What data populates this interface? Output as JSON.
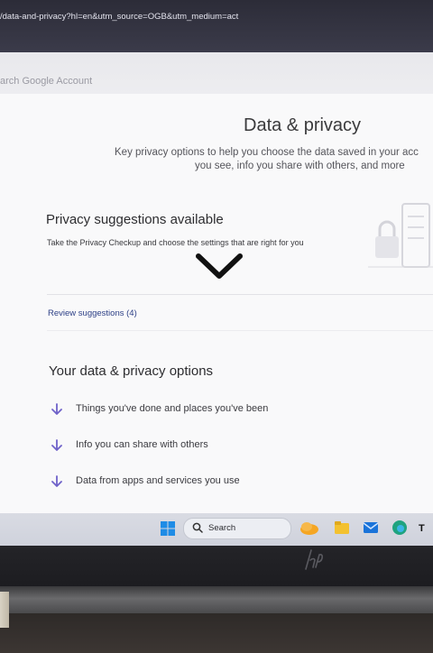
{
  "browser": {
    "url_fragment": "/data-and-privacy?hl=en&utm_source=OGB&utm_medium=act"
  },
  "header": {
    "search_placeholder": "arch Google Account"
  },
  "page": {
    "title": "Data & privacy",
    "subtitle_line1": "Key privacy options to help you choose the data saved in your acc",
    "subtitle_line2": "you see, info you share with others, and more"
  },
  "privacy_suggestions": {
    "title": "Privacy suggestions available",
    "description": "Take the Privacy Checkup and choose the settings that are right for you",
    "review_link": "Review suggestions (4)"
  },
  "options": {
    "title": "Your data & privacy options",
    "items": [
      {
        "label": "Things you've done and places you've been",
        "icon": "arrow-down-icon"
      },
      {
        "label": "Info you can share with others",
        "icon": "arrow-down-icon"
      },
      {
        "label": "Data from apps and services you use",
        "icon": "arrow-down-icon"
      }
    ]
  },
  "taskbar": {
    "search_label": "Search",
    "icons": [
      "windows-start-icon",
      "weather-icon",
      "file-explorer-icon",
      "mail-icon",
      "edge-icon"
    ]
  },
  "colors": {
    "accent": "#6f62c9",
    "link": "#2c3f86",
    "url_bar": "#33333f"
  }
}
